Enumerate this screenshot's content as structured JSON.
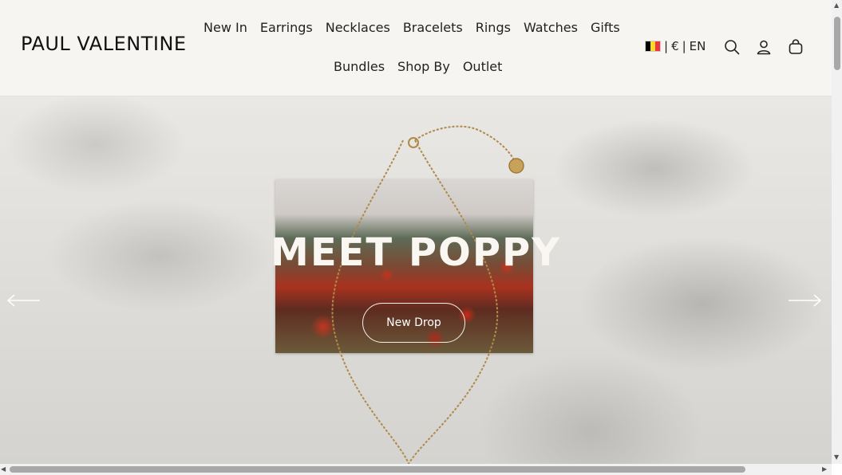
{
  "header": {
    "logo": "PAUL VALENTINE",
    "nav_row1": [
      "New In",
      "Earrings",
      "Necklaces",
      "Bracelets",
      "Rings",
      "Watches",
      "Gifts"
    ],
    "nav_row2": [
      "Bundles",
      "Shop By",
      "Outlet"
    ],
    "locale": {
      "currency": "€",
      "language": "EN",
      "flag_colors": [
        "#000000",
        "#FDDA24",
        "#EF3340"
      ]
    },
    "icons": [
      "search-icon",
      "account-icon",
      "cart-icon"
    ]
  },
  "hero": {
    "title": "MEET POPPY",
    "cta_label": "New Drop"
  },
  "colors": {
    "header_bg": "#f6f5f1",
    "text": "#1a1a1a",
    "hero_text": "#faf7f2"
  }
}
